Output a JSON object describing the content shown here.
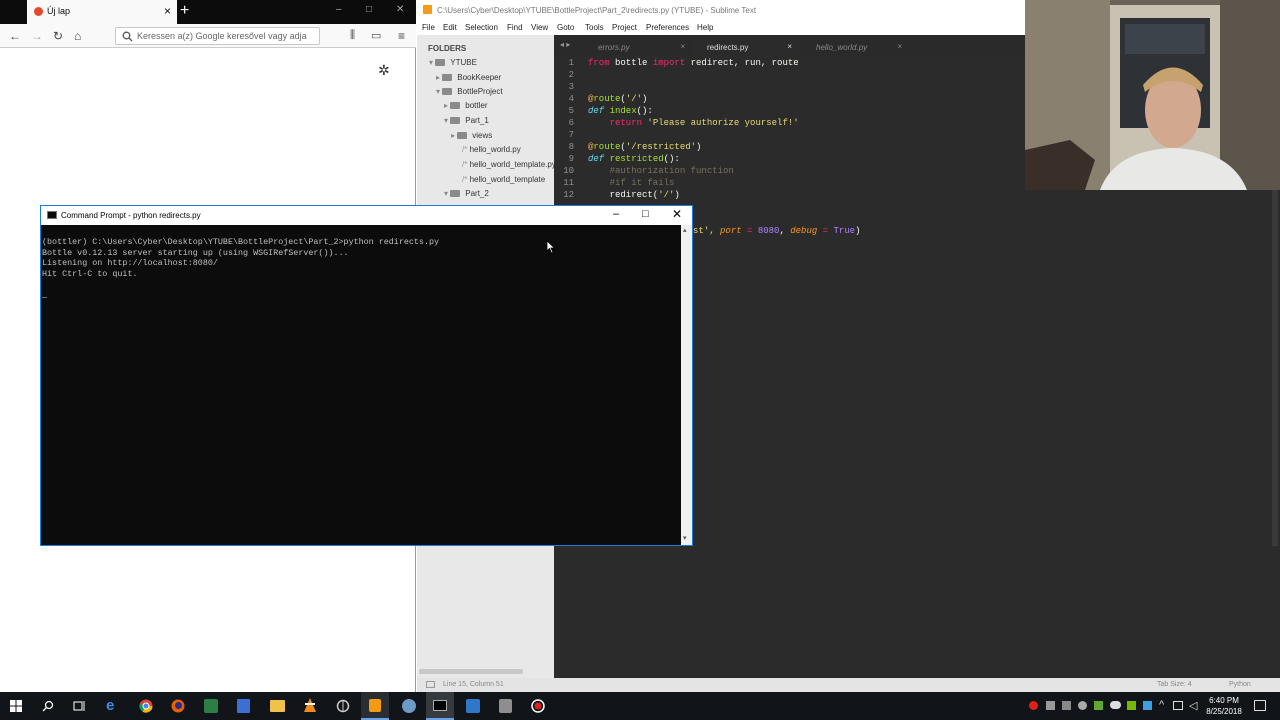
{
  "firefox": {
    "tab_title": "Új lap",
    "url_placeholder": "Keressen a(z) Google keresővel vagy adja",
    "colors": {
      "tabbar": "#0c0c0d",
      "toolbar": "#f9f9fa"
    }
  },
  "sublime": {
    "window_title": "C:\\Users\\Cyber\\Desktop\\YTUBE\\BottleProject\\Part_2\\redirects.py (YTUBE) - Sublime Text",
    "menu": [
      "File",
      "Edit",
      "Selection",
      "Find",
      "View",
      "Goto",
      "Tools",
      "Project",
      "Preferences",
      "Help"
    ],
    "sidebar_header": "FOLDERS",
    "tree": [
      "YTUBE",
      "BookKeeper",
      "BottleProject",
      "bottler",
      "Part_1",
      "views",
      "hello_world.py",
      "hello_world_template.py",
      "hello_world_template",
      "Part_2"
    ],
    "tabs": [
      "errors.py",
      "redirects.py",
      "hello_world.py"
    ],
    "line_numbers": [
      "1",
      "2",
      "3",
      "4",
      "5",
      "6",
      "7",
      "8",
      "9",
      "10",
      "11",
      "12"
    ],
    "code_line15_tail_a": "st', ",
    "code_line15_kw_port": "port",
    "code_line15_eq": " = ",
    "code_line15_num": "8080",
    "code_line15_comma": ", ",
    "code_line15_kw_debug": "debug",
    "code_line15_eq2": " = ",
    "code_line15_true": "True",
    "code_line15_close": ")",
    "status_pos": "Line 15, Column 51",
    "status_tab": "Tab Size: 4",
    "status_lang": "Python",
    "colors": {
      "editor_bg": "#2b2b2b",
      "sidebar_bg": "#e8e8e8",
      "keyword": "#f92672",
      "string": "#e6db74",
      "func": "#a6e22e",
      "decorator": "#f4a85b",
      "comment": "#75715e",
      "number": "#ae81ff"
    }
  },
  "cmd": {
    "title": "Command Prompt - python  redirects.py",
    "lines": [
      "(bottler) C:\\Users\\Cyber\\Desktop\\YTUBE\\BottleProject\\Part_2>python redirects.py",
      "Bottle v0.12.13 server starting up (using WSGIRefServer())...",
      "Listening on http://localhost:8080/",
      "Hit Ctrl-C to quit."
    ],
    "cursor": "_"
  },
  "taskbar": {
    "time": "6:40 PM",
    "date": "8/25/2018",
    "icons": [
      "windows-start-icon",
      "search-icon",
      "task-view-icon",
      "edge-icon",
      "chrome-icon",
      "firefox-icon",
      "app-icon",
      "save-icon",
      "folder-icon",
      "vlc-icon",
      "sync-icon",
      "sublime-icon",
      "network-settings-icon",
      "cmd-icon",
      "vs-code-icon",
      "stack-icon",
      "record-icon"
    ]
  }
}
